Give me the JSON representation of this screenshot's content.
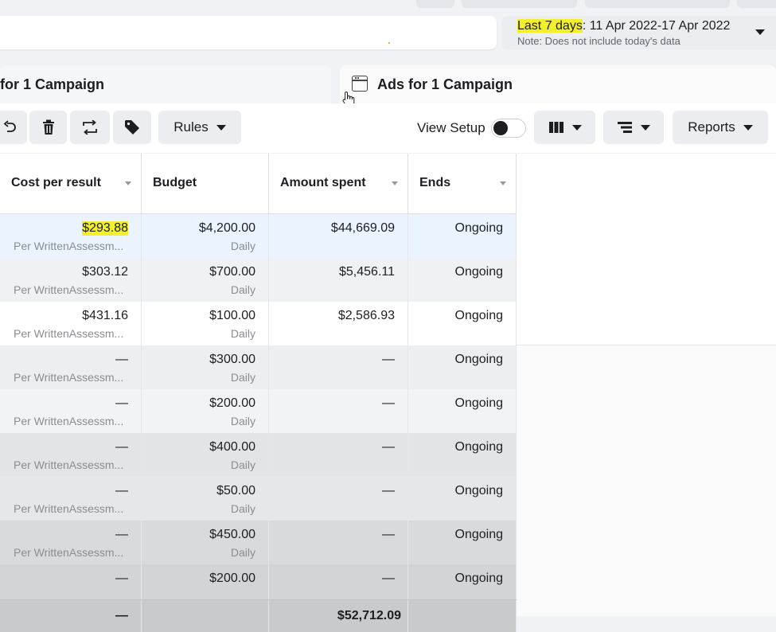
{
  "date_range": {
    "preset": "Last 7 days",
    "range": ": 11 Apr 2022-17 Apr 2022",
    "note": "Note: Does not include today's data"
  },
  "tabs": {
    "campaigns_partial": "for 1 Campaign",
    "ads": "Ads for 1 Campaign"
  },
  "toolbar": {
    "rules_label": "Rules",
    "view_setup_label": "View Setup",
    "reports_label": "Reports"
  },
  "columns": {
    "cost_per_result": "Cost per result",
    "budget": "Budget",
    "amount_spent": "Amount spent",
    "ends": "Ends"
  },
  "rows": [
    {
      "cost": "$293.88",
      "cost_sub": "Per WrittenAssessm...",
      "budget": "$4,200.00",
      "budget_sub": "Daily",
      "spent": "$44,669.09",
      "ends": "Ongoing"
    },
    {
      "cost": "$303.12",
      "cost_sub": "Per WrittenAssessm...",
      "budget": "$700.00",
      "budget_sub": "Daily",
      "spent": "$5,456.11",
      "ends": "Ongoing"
    },
    {
      "cost": "$431.16",
      "cost_sub": "Per WrittenAssessm...",
      "budget": "$100.00",
      "budget_sub": "Daily",
      "spent": "$2,586.93",
      "ends": "Ongoing"
    },
    {
      "cost": "—",
      "cost_sub": "Per WrittenAssessm...",
      "budget": "$300.00",
      "budget_sub": "Daily",
      "spent": "—",
      "ends": "Ongoing"
    },
    {
      "cost": "—",
      "cost_sub": "Per WrittenAssessm...",
      "budget": "$200.00",
      "budget_sub": "Daily",
      "spent": "—",
      "ends": "Ongoing"
    },
    {
      "cost": "—",
      "cost_sub": "Per WrittenAssessm...",
      "budget": "$400.00",
      "budget_sub": "Daily",
      "spent": "—",
      "ends": "Ongoing"
    },
    {
      "cost": "—",
      "cost_sub": "Per WrittenAssessm...",
      "budget": "$50.00",
      "budget_sub": "Daily",
      "spent": "—",
      "ends": "Ongoing"
    },
    {
      "cost": "—",
      "cost_sub": "Per WrittenAssessm...",
      "budget": "$450.00",
      "budget_sub": "Daily",
      "spent": "—",
      "ends": "Ongoing"
    },
    {
      "cost": "—",
      "cost_sub": "",
      "budget": "$200.00",
      "budget_sub": "",
      "spent": "—",
      "ends": "Ongoing"
    }
  ],
  "totals": {
    "cost": "—",
    "spent": "$52,712.09"
  },
  "colors": {
    "highlight": "#f3ef2a",
    "selected_row": "#ebf3ff"
  }
}
